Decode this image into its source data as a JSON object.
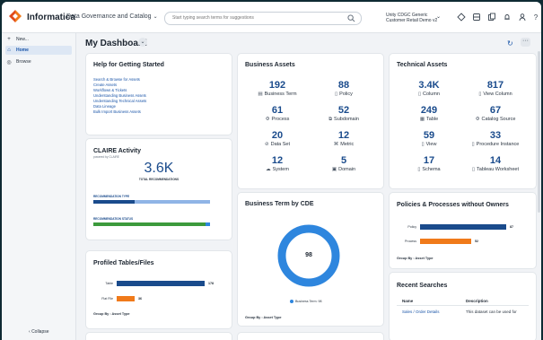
{
  "topbar": {
    "brand": "Informatica",
    "product": "Data Governance and Catalog",
    "search_placeholder": "Start typing search terms for suggestions",
    "org_line1": "Unity CDGC Generic",
    "org_line2": "Customer Retail Demo v2",
    "icons": [
      "feature-icon",
      "database-icon",
      "copy-icon",
      "bell-icon",
      "person-icon",
      "help-icon"
    ],
    "help_glyph": "?"
  },
  "sidebar": {
    "items": [
      {
        "label": "New...",
        "icon": "plus-icon",
        "glyph": "+"
      },
      {
        "label": "Home",
        "icon": "home-icon",
        "glyph": "⌂"
      },
      {
        "label": "Browse",
        "icon": "compass-icon",
        "glyph": "◎"
      }
    ],
    "collapse_label": "Collapse",
    "collapse_glyph": "‹"
  },
  "header": {
    "title": "My Dashboard",
    "chevron": "⌄",
    "refresh_glyph": "↻",
    "more_glyph": "···"
  },
  "help_card": {
    "title": "Help for Getting Started",
    "links": [
      "Search & Browse for Assets",
      "Create Assets",
      "Workflows & Tickets",
      "Understanding Business Assets",
      "Understanding Technical Assets",
      "Data Lineage",
      "Bulk Import Business Assets"
    ]
  },
  "claire": {
    "title": "CLAIRE Activity",
    "powered": "powered by CLAIRE",
    "value": "3.6K",
    "caption": "TOTAL RECOMMENDATIONS",
    "type_label": "RECOMMENDATION TYPE",
    "status_label": "RECOMMENDATION STATUS",
    "type_segments": [
      {
        "share": 0.35,
        "color": "#1a4b8c"
      },
      {
        "share": 0.65,
        "color": "#8fb4e6"
      }
    ],
    "status_segments": [
      {
        "share": 0.96,
        "color": "#3c9a3c"
      },
      {
        "share": 0.04,
        "color": "#2e86de"
      }
    ]
  },
  "business_assets": {
    "title": "Business Assets",
    "items": [
      {
        "value": "192",
        "label": "Business Term",
        "glyph": "▤"
      },
      {
        "value": "88",
        "label": "Policy",
        "glyph": "▯"
      },
      {
        "value": "61",
        "label": "Process",
        "glyph": "⚙"
      },
      {
        "value": "52",
        "label": "Subdomain",
        "glyph": "⧉"
      },
      {
        "value": "20",
        "label": "Data Set",
        "glyph": "⊘"
      },
      {
        "value": "12",
        "label": "Metric",
        "glyph": "⌘"
      },
      {
        "value": "12",
        "label": "System",
        "glyph": "☁"
      },
      {
        "value": "5",
        "label": "Domain",
        "glyph": "▣"
      }
    ]
  },
  "technical_assets": {
    "title": "Technical Assets",
    "items": [
      {
        "value": "3.4K",
        "label": "Column",
        "glyph": "▯"
      },
      {
        "value": "817",
        "label": "View Column",
        "glyph": "▯"
      },
      {
        "value": "249",
        "label": "Table",
        "glyph": "▦"
      },
      {
        "value": "67",
        "label": "Catalog Source",
        "glyph": "⚙"
      },
      {
        "value": "59",
        "label": "View",
        "glyph": "▯"
      },
      {
        "value": "33",
        "label": "Procedure Instance",
        "glyph": "▯"
      },
      {
        "value": "17",
        "label": "Schema",
        "glyph": "▯"
      },
      {
        "value": "14",
        "label": "Tableau Worksheet",
        "glyph": "▯"
      }
    ]
  },
  "term_by_cde": {
    "title": "Business Term by CDE",
    "total": "98",
    "legend": "Business Term: 98",
    "group_by": "Group By : Asset Type",
    "color": "#2e86de"
  },
  "policies": {
    "title": "Policies & Processes without Owners",
    "group_by": "Group By : Asset Type",
    "max": 100,
    "rows": [
      {
        "label": "Policy",
        "value": 87,
        "color": "#1a4b8c"
      },
      {
        "label": "Process",
        "value": 52,
        "color": "#f07a1a"
      }
    ]
  },
  "profiled": {
    "title": "Profiled Tables/Files",
    "group_by": "Group By : Asset Type",
    "max": 200,
    "rows": [
      {
        "label": "Table",
        "value": 178,
        "color": "#1a4b8c"
      },
      {
        "label": "Flat File",
        "value": 36,
        "color": "#f07a1a"
      }
    ]
  },
  "recent_searches": {
    "title": "Recent Searches",
    "columns": [
      "Name",
      "Description"
    ],
    "rows": [
      {
        "name": "Sales / Order Details",
        "description": "This dataset can be used for"
      }
    ]
  }
}
